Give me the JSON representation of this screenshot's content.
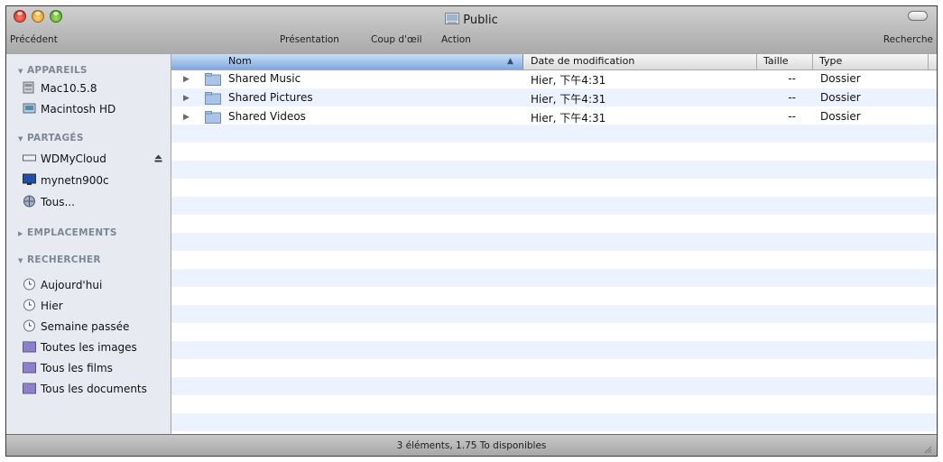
{
  "window": {
    "title": "Public",
    "title_icon": "network-folder-icon"
  },
  "toolbar": {
    "back_label": "Précédent",
    "view_label": "Présentation",
    "quicklook_label": "Coup d'œil",
    "action_label": "Action",
    "search_label": "Recherche"
  },
  "sidebar": {
    "sections": [
      {
        "label": "APPAREILS",
        "expanded": true,
        "items": [
          {
            "label": "Mac10.5.8",
            "icon": "computer-icon"
          },
          {
            "label": "Macintosh HD",
            "icon": "hard-drive-icon"
          }
        ]
      },
      {
        "label": "PARTAGÉS",
        "expanded": true,
        "items": [
          {
            "label": "WDMyCloud",
            "icon": "network-drive-icon",
            "eject": true
          },
          {
            "label": "mynetn900c",
            "icon": "monitor-icon"
          },
          {
            "label": "Tous...",
            "icon": "network-globe-icon"
          }
        ]
      },
      {
        "label": "EMPLACEMENTS",
        "expanded": false,
        "items": []
      },
      {
        "label": "RECHERCHER",
        "expanded": true,
        "items": [
          {
            "label": "Aujourd'hui",
            "icon": "clock-icon"
          },
          {
            "label": "Hier",
            "icon": "clock-icon"
          },
          {
            "label": "Semaine passée",
            "icon": "clock-icon"
          },
          {
            "label": "Toutes les images",
            "icon": "smart-folder-icon"
          },
          {
            "label": "Tous les films",
            "icon": "smart-folder-icon"
          },
          {
            "label": "Tous les documents",
            "icon": "smart-folder-icon"
          }
        ]
      }
    ]
  },
  "list": {
    "columns": {
      "name": "Nom",
      "date": "Date de modification",
      "size": "Taille",
      "type": "Type"
    },
    "sort_column": "Nom",
    "rows": [
      {
        "name": "Shared Music",
        "date": "Hier, 下午4:31",
        "size": "--",
        "type": "Dossier"
      },
      {
        "name": "Shared Pictures",
        "date": "Hier, 下午4:31",
        "size": "--",
        "type": "Dossier"
      },
      {
        "name": "Shared Videos",
        "date": "Hier, 下午4:31",
        "size": "--",
        "type": "Dossier"
      }
    ]
  },
  "status": {
    "text": "3 éléments, 1.75 To disponibles"
  },
  "colors": {
    "sidebar_bg": "#e7ebf1",
    "stripe": "#edf3fe",
    "selected_header": "#7fa8e0",
    "section_header": "#7e8795"
  }
}
